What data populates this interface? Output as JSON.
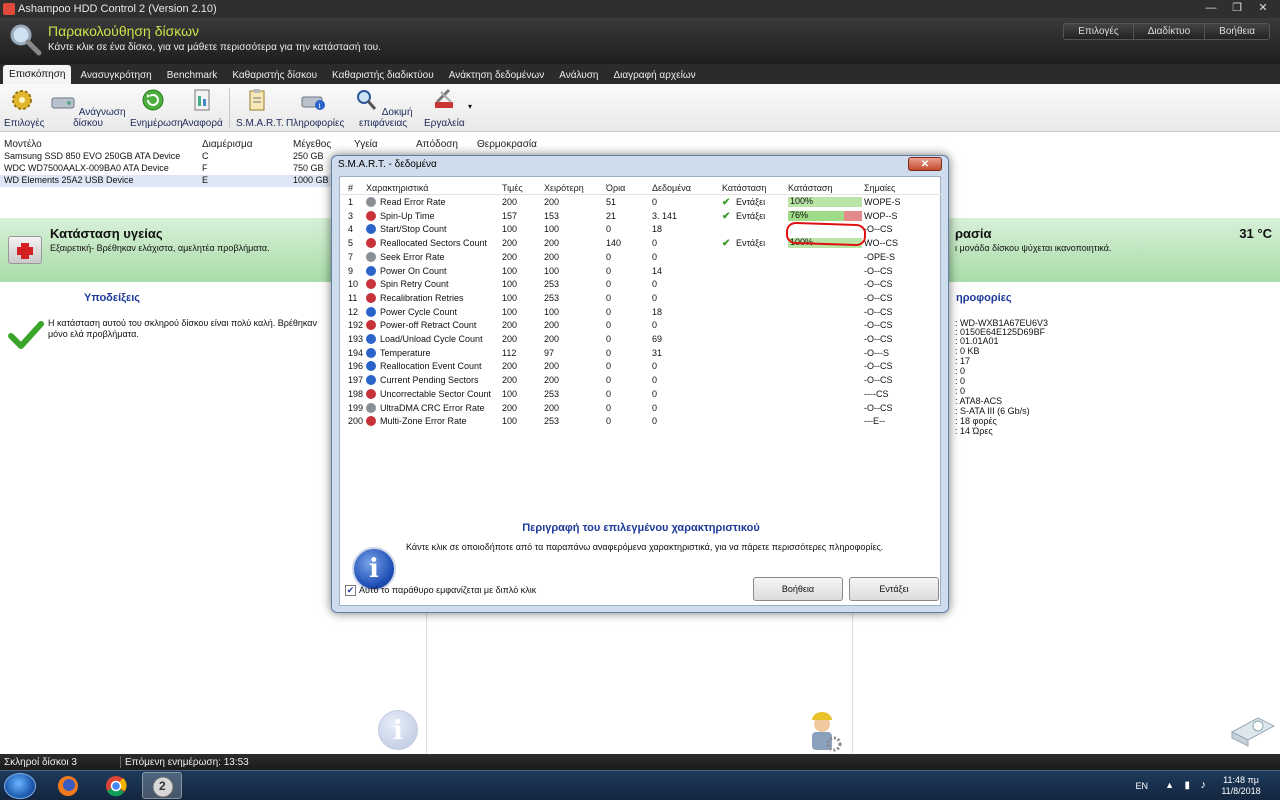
{
  "window": {
    "title": "Ashampoo HDD Control 2 (Version 2.10)",
    "controls": [
      "—",
      "❐",
      "✕"
    ]
  },
  "header": {
    "title": "Παρακολούθηση δίσκων",
    "subtitle": "Κάντε κλικ σε ένα δίσκο, για να μάθετε περισσότερα για την κατάστασή του.",
    "buttons": [
      "Επιλογές",
      "Διαδίκτυο",
      "Βοήθεια"
    ]
  },
  "tabs": [
    "Επισκόπηση",
    "Ανασυγκρότηση",
    "Benchmark",
    "Καθαριστής δίσκου",
    "Καθαριστής διαδικτύου",
    "Ανάκτηση δεδομένων",
    "Ανάλυση",
    "Διαγραφή αρχείων"
  ],
  "toolbar": {
    "options": "Επιλογές",
    "scan": "Ανάγνωση δίσκου",
    "update": "Ενημέρωση",
    "report": "Αναφορά",
    "smart": "S.M.A.R.T.",
    "info": "Πληροφορίες",
    "surface": "Δοκιμή επιφάνειας",
    "tools": "Εργαλεία"
  },
  "disks": {
    "headers": [
      "Μοντέλο",
      "Διαμέρισμα",
      "Μέγεθος",
      "Υγεία",
      "Απόδοση",
      "Θερμοκρασία"
    ],
    "rows": [
      {
        "model": "Samsung SSD 850 EVO 250GB ATA Device",
        "partition": "C",
        "size": "250 GB"
      },
      {
        "model": "WDC WD7500AALX-009BA0 ATA Device",
        "partition": "F",
        "size": "750 GB"
      },
      {
        "model": "WD Elements 25A2 USB Device",
        "partition": "E",
        "size": "1000 GB"
      }
    ]
  },
  "health": {
    "title": "Κατάσταση υγείας",
    "text": "Εξαιρετική- Βρέθηκαν ελάχιστα, αμελητέα προβλήματα.",
    "temp_title": "ρασία",
    "temp_text": "ι μονάδα δίσκου ψύχεται ικανοποιητικά.",
    "temp_value": "31 °C"
  },
  "tips": {
    "title": "Υποδείξεις",
    "text": "Η κατάσταση αυτού του σκληρού δίσκου είναι πολύ καλή. Βρέθηκαν μόνο ελά προβλήματα."
  },
  "info": {
    "title": "ηροφορίες",
    "values": [
      ": WD-WXB1A67EU6V3",
      ": 0150E64E125D69BF",
      ": 01.01A01",
      ": 0 KB",
      ": 17",
      ": 0",
      ": 0",
      ": 0",
      ": ATA8-ACS",
      ": S-ATA III (6 Gb/s)",
      ": 18 φορές",
      ": 14 Ώρες"
    ]
  },
  "status": {
    "disks": "Σκληροί δίσκοι 3",
    "next_update": "Επόμενη ενημέρωση: 13:53"
  },
  "taskbar": {
    "lang": "EN",
    "time": "11:48 πμ",
    "date": "11/8/2018",
    "app_label": "2"
  },
  "dialog": {
    "title": "S.M.A.R.T. - δεδομένα",
    "close": "✕",
    "headers": [
      "#",
      "Χαρακτηριστικά",
      "Τιμές",
      "Χειρότερη",
      "Όρια",
      "Δεδομένα",
      "Κατάσταση",
      "Κατάσταση",
      "Σημαίες"
    ],
    "rows": [
      {
        "id": "1",
        "name": "Read Error Rate",
        "value": "200",
        "worst": "200",
        "threshold": "51",
        "data": "0",
        "status": "Εντάξει",
        "health": 100,
        "health_label": "100%",
        "flags": "WOPE-S",
        "icon": "gauge"
      },
      {
        "id": "3",
        "name": "Spin-Up Time",
        "value": "157",
        "worst": "153",
        "threshold": "21",
        "data": "3. 141",
        "status": "Εντάξει",
        "health": 76,
        "health_label": "76%",
        "flags": "WOP--S",
        "icon": "pin"
      },
      {
        "id": "4",
        "name": "Start/Stop Count",
        "value": "100",
        "worst": "100",
        "threshold": "0",
        "data": "18",
        "status": "",
        "health": null,
        "health_label": "",
        "flags": "-O--CS",
        "icon": "info"
      },
      {
        "id": "5",
        "name": "Reallocated Sectors Count",
        "value": "200",
        "worst": "200",
        "threshold": "140",
        "data": "0",
        "status": "Εντάξει",
        "health": 100,
        "health_label": "100%",
        "flags": "WO--CS",
        "icon": "pin"
      },
      {
        "id": "7",
        "name": "Seek Error Rate",
        "value": "200",
        "worst": "200",
        "threshold": "0",
        "data": "0",
        "status": "",
        "health": null,
        "health_label": "",
        "flags": "-OPE-S",
        "icon": "gauge"
      },
      {
        "id": "9",
        "name": "Power On Count",
        "value": "100",
        "worst": "100",
        "threshold": "0",
        "data": "14",
        "status": "",
        "health": null,
        "health_label": "",
        "flags": "-O--CS",
        "icon": "info"
      },
      {
        "id": "10",
        "name": "Spin Retry Count",
        "value": "100",
        "worst": "253",
        "threshold": "0",
        "data": "0",
        "status": "",
        "health": null,
        "health_label": "",
        "flags": "-O--CS",
        "icon": "pin"
      },
      {
        "id": "11",
        "name": "Recalibration Retries",
        "value": "100",
        "worst": "253",
        "threshold": "0",
        "data": "0",
        "status": "",
        "health": null,
        "health_label": "",
        "flags": "-O--CS",
        "icon": "pin"
      },
      {
        "id": "12",
        "name": "Power Cycle Count",
        "value": "100",
        "worst": "100",
        "threshold": "0",
        "data": "18",
        "status": "",
        "health": null,
        "health_label": "",
        "flags": "-O--CS",
        "icon": "info"
      },
      {
        "id": "192",
        "name": "Power-off Retract Count",
        "value": "200",
        "worst": "200",
        "threshold": "0",
        "data": "0",
        "status": "",
        "health": null,
        "health_label": "",
        "flags": "-O--CS",
        "icon": "pin"
      },
      {
        "id": "193",
        "name": "Load/Unload Cycle Count",
        "value": "200",
        "worst": "200",
        "threshold": "0",
        "data": "69",
        "status": "",
        "health": null,
        "health_label": "",
        "flags": "-O--CS",
        "icon": "info"
      },
      {
        "id": "194",
        "name": "Temperature",
        "value": "112",
        "worst": "97",
        "threshold": "0",
        "data": "31",
        "status": "",
        "health": null,
        "health_label": "",
        "flags": "-O---S",
        "icon": "info"
      },
      {
        "id": "196",
        "name": "Reallocation Event Count",
        "value": "200",
        "worst": "200",
        "threshold": "0",
        "data": "0",
        "status": "",
        "health": null,
        "health_label": "",
        "flags": "-O--CS",
        "icon": "info"
      },
      {
        "id": "197",
        "name": "Current Pending Sectors",
        "value": "200",
        "worst": "200",
        "threshold": "0",
        "data": "0",
        "status": "",
        "health": null,
        "health_label": "",
        "flags": "-O--CS",
        "icon": "info"
      },
      {
        "id": "198",
        "name": "Uncorrectable Sector Count",
        "value": "100",
        "worst": "253",
        "threshold": "0",
        "data": "0",
        "status": "",
        "health": null,
        "health_label": "",
        "flags": "----CS",
        "icon": "pin"
      },
      {
        "id": "199",
        "name": "UltraDMA CRC Error Rate",
        "value": "200",
        "worst": "200",
        "threshold": "0",
        "data": "0",
        "status": "",
        "health": null,
        "health_label": "",
        "flags": "-O--CS",
        "icon": "gauge"
      },
      {
        "id": "200",
        "name": "Multi-Zone Error Rate",
        "value": "100",
        "worst": "253",
        "threshold": "0",
        "data": "0",
        "status": "",
        "health": null,
        "health_label": "",
        "flags": "---E--",
        "icon": "pin"
      }
    ],
    "desc_title": "Περιγραφή του επιλεγμένου χαρακτηριστικού",
    "desc_text": "Κάντε κλικ σε οποιοδήποτε από τα παραπάνω αναφερόμενα χαρακτηριστικά, για να πάρετε περισσότερες πληροφορίες.",
    "checkbox_label": "Αυτό το παράθυρο εμφανίζεται με διπλό κλικ",
    "checkbox_checked": true,
    "help_button": "Βοήθεια",
    "ok_button": "Εντάξει"
  }
}
